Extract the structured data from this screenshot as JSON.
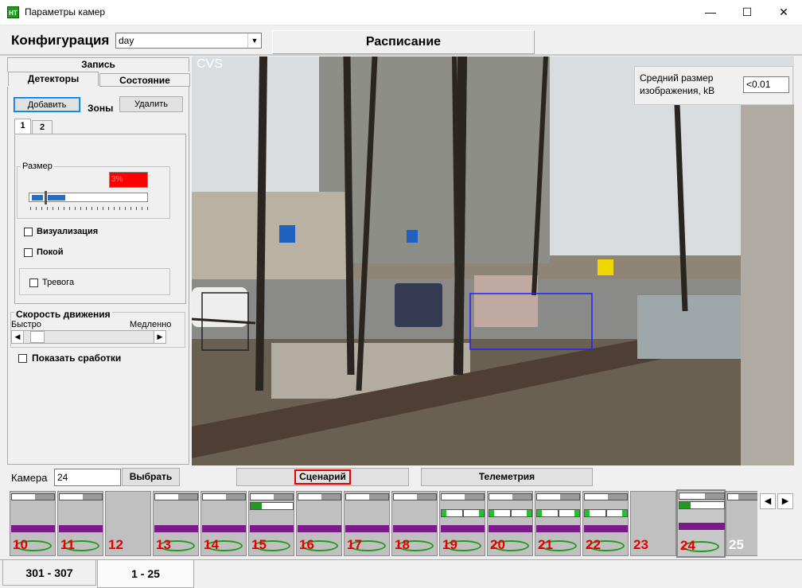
{
  "window": {
    "title": "Параметры камер",
    "minimize": "—",
    "maximize": "☐",
    "close": "✕",
    "icon_text": "НТ"
  },
  "config": {
    "label": "Конфигурация",
    "value": "day"
  },
  "schedule_label": "Расписание",
  "tabs": {
    "record": "Запись",
    "detectors": "Детекторы",
    "state": "Состояние"
  },
  "zones": {
    "add": "Добавить",
    "label": "Зоны",
    "delete": "Удалить",
    "tabs": [
      "1",
      "2"
    ]
  },
  "size_group": {
    "title": "Размер",
    "value": "3%"
  },
  "checks": {
    "visualization": "Визуализация",
    "rest": "Покой",
    "alarm": "Тревога"
  },
  "speed": {
    "title": "Скорость движения",
    "fast": "Быстро",
    "slow": "Медленно"
  },
  "show_triggers": "Показать сработки",
  "video": {
    "overlay": "CVS",
    "avg_size_label": "Средний размер изображения, kB",
    "avg_size_value": "<0.01"
  },
  "camera": {
    "label": "Камера",
    "value": "24",
    "select_btn": "Выбрать",
    "scenario_btn": "Сценарий",
    "telemetry_btn": "Телеметрия"
  },
  "tiles": [
    {
      "num": "10"
    },
    {
      "num": "11"
    },
    {
      "num": "12"
    },
    {
      "num": "13"
    },
    {
      "num": "14"
    },
    {
      "num": "15"
    },
    {
      "num": "16"
    },
    {
      "num": "17"
    },
    {
      "num": "18"
    },
    {
      "num": "19"
    },
    {
      "num": "20"
    },
    {
      "num": "21"
    },
    {
      "num": "22"
    },
    {
      "num": "23"
    },
    {
      "num": "24"
    },
    {
      "num": "25"
    }
  ],
  "bottom_tabs": [
    "301 - 307",
    "1 - 25"
  ],
  "colors": {
    "alarm_red": "#e60000",
    "green": "#1f9b1f",
    "purple": "#7c1a8c",
    "zone_blue": "#2020ff"
  }
}
